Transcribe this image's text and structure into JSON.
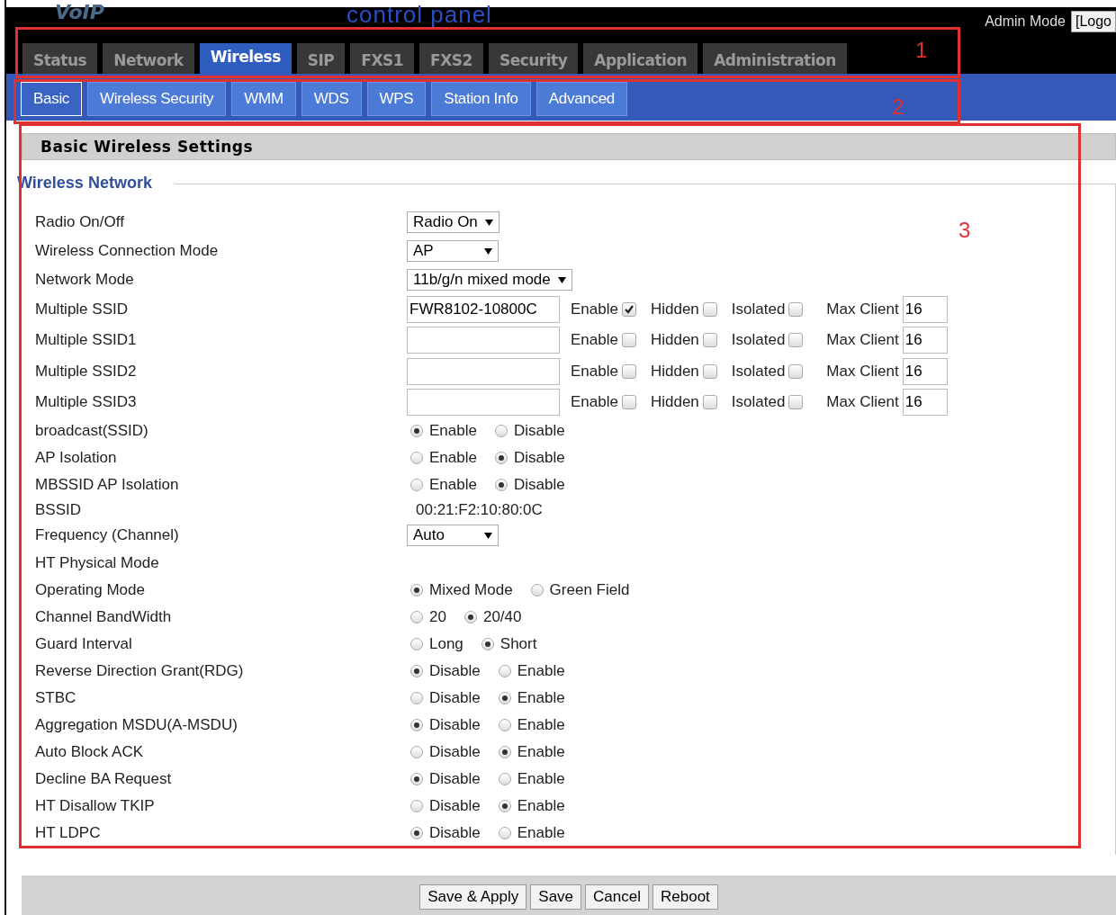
{
  "header": {
    "logo": "VoIP",
    "subtitle": "control panel",
    "admin_mode": "Admin Mode",
    "logout": "[Logo"
  },
  "tabs": [
    {
      "label": "Status",
      "selected": false
    },
    {
      "label": "Network",
      "selected": false
    },
    {
      "label": "Wireless",
      "selected": true
    },
    {
      "label": "SIP",
      "selected": false
    },
    {
      "label": "FXS1",
      "selected": false
    },
    {
      "label": "FXS2",
      "selected": false
    },
    {
      "label": "Security",
      "selected": false
    },
    {
      "label": "Application",
      "selected": false
    },
    {
      "label": "Administration",
      "selected": false
    }
  ],
  "subtabs": [
    {
      "label": "Basic",
      "selected": true
    },
    {
      "label": "Wireless Security",
      "selected": false
    },
    {
      "label": "WMM",
      "selected": false
    },
    {
      "label": "WDS",
      "selected": false
    },
    {
      "label": "WPS",
      "selected": false
    },
    {
      "label": "Station Info",
      "selected": false
    },
    {
      "label": "Advanced",
      "selected": false
    }
  ],
  "section_title": "Basic Wireless Settings",
  "fieldset_legend": "Wireless Network",
  "rows": [
    {
      "label": "Radio On/Off",
      "kind": "select",
      "value": "Radio On"
    },
    {
      "label": "Wireless Connection Mode",
      "kind": "select",
      "value": "AP"
    },
    {
      "label": "Network Mode",
      "kind": "select",
      "value": "11b/g/n mixed mode"
    },
    {
      "label": "Multiple SSID",
      "kind": "ssid",
      "value": "FWR8102-10800C",
      "checks": [
        {
          "label": "Enable",
          "checked": true
        },
        {
          "label": "Hidden",
          "checked": false
        },
        {
          "label": "Isolated",
          "checked": false
        }
      ],
      "max_label": "Max Client",
      "max_value": "16"
    },
    {
      "label": "Multiple SSID1",
      "kind": "ssid",
      "checks": [
        {
          "label": "Enable",
          "checked": false
        },
        {
          "label": "Hidden",
          "checked": false
        },
        {
          "label": "Isolated",
          "checked": false
        }
      ],
      "max_label": "Max Client",
      "max_value": "16"
    },
    {
      "label": "Multiple SSID2",
      "kind": "ssid",
      "checks": [
        {
          "label": "Enable",
          "checked": false
        },
        {
          "label": "Hidden",
          "checked": false
        },
        {
          "label": "Isolated",
          "checked": false
        }
      ],
      "max_label": "Max Client",
      "max_value": "16"
    },
    {
      "label": "Multiple SSID3",
      "kind": "ssid",
      "checks": [
        {
          "label": "Enable",
          "checked": false
        },
        {
          "label": "Hidden",
          "checked": false
        },
        {
          "label": "Isolated",
          "checked": false
        }
      ],
      "max_label": "Max Client",
      "max_value": "16"
    },
    {
      "label": "broadcast(SSID)",
      "kind": "radio",
      "options": [
        {
          "label": "Enable",
          "selected": true
        },
        {
          "label": "Disable",
          "selected": false
        }
      ]
    },
    {
      "label": "AP Isolation",
      "kind": "radio",
      "options": [
        {
          "label": "Enable",
          "selected": false
        },
        {
          "label": "Disable",
          "selected": true
        }
      ]
    },
    {
      "label": "MBSSID AP Isolation",
      "kind": "radio",
      "options": [
        {
          "label": "Enable",
          "selected": false
        },
        {
          "label": "Disable",
          "selected": true
        }
      ]
    },
    {
      "label": "BSSID",
      "kind": "text",
      "value": "00:21:F2:10:80:0C"
    },
    {
      "label": "Frequency (Channel)",
      "kind": "select",
      "value": "Auto"
    },
    {
      "label": "HT Physical Mode",
      "kind": "heading"
    },
    {
      "label": "Operating Mode",
      "kind": "radio",
      "options": [
        {
          "label": "Mixed Mode",
          "selected": true
        },
        {
          "label": "Green Field",
          "selected": false
        }
      ]
    },
    {
      "label": "Channel BandWidth",
      "kind": "radio",
      "options": [
        {
          "label": "20",
          "selected": false
        },
        {
          "label": "20/40",
          "selected": true
        }
      ]
    },
    {
      "label": "Guard Interval",
      "kind": "radio",
      "options": [
        {
          "label": "Long",
          "selected": false
        },
        {
          "label": "Short",
          "selected": true
        }
      ]
    },
    {
      "label": "Reverse Direction Grant(RDG)",
      "kind": "radio",
      "options": [
        {
          "label": "Disable",
          "selected": true
        },
        {
          "label": "Enable",
          "selected": false
        }
      ]
    },
    {
      "label": "STBC",
      "kind": "radio",
      "options": [
        {
          "label": "Disable",
          "selected": false
        },
        {
          "label": "Enable",
          "selected": true
        }
      ]
    },
    {
      "label": "Aggregation MSDU(A-MSDU)",
      "kind": "radio",
      "options": [
        {
          "label": "Disable",
          "selected": true
        },
        {
          "label": "Enable",
          "selected": false
        }
      ]
    },
    {
      "label": "Auto Block ACK",
      "kind": "radio",
      "options": [
        {
          "label": "Disable",
          "selected": false
        },
        {
          "label": "Enable",
          "selected": true
        }
      ]
    },
    {
      "label": "Decline BA Request",
      "kind": "radio",
      "options": [
        {
          "label": "Disable",
          "selected": true
        },
        {
          "label": "Enable",
          "selected": false
        }
      ]
    },
    {
      "label": "HT Disallow TKIP",
      "kind": "radio",
      "options": [
        {
          "label": "Disable",
          "selected": false
        },
        {
          "label": "Enable",
          "selected": true
        }
      ]
    },
    {
      "label": "HT LDPC",
      "kind": "radio",
      "options": [
        {
          "label": "Disable",
          "selected": true
        },
        {
          "label": "Enable",
          "selected": false
        }
      ]
    }
  ],
  "buttons": [
    "Save & Apply",
    "Save",
    "Cancel",
    "Reboot"
  ],
  "annotations": [
    "1",
    "2",
    "3"
  ]
}
